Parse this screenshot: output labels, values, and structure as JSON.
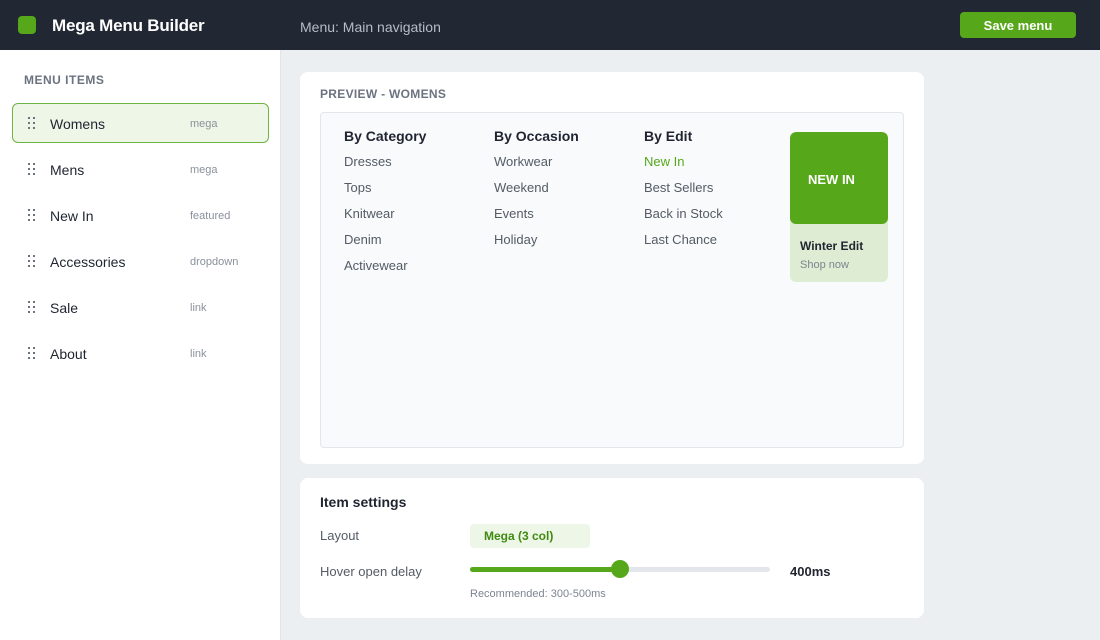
{
  "header": {
    "app_title": "Mega Menu Builder",
    "menu_name": "Menu: Main navigation",
    "save_label": "Save menu"
  },
  "sidebar": {
    "heading": "MENU ITEMS",
    "items": [
      {
        "label": "Womens",
        "type": "mega",
        "active": true
      },
      {
        "label": "Mens",
        "type": "mega"
      },
      {
        "label": "New In",
        "type": "featured"
      },
      {
        "label": "Accessories",
        "type": "dropdown"
      },
      {
        "label": "Sale",
        "type": "link"
      },
      {
        "label": "About",
        "type": "link"
      }
    ]
  },
  "preview": {
    "label": "PREVIEW",
    "separator": "-",
    "item": "WOMENS",
    "columns": [
      {
        "title": "By Category",
        "links": [
          "Dresses",
          "Tops",
          "Knitwear",
          "Denim",
          "Activewear"
        ]
      },
      {
        "title": "By Occasion",
        "links": [
          "Workwear",
          "Weekend",
          "Events",
          "Holiday"
        ]
      },
      {
        "title": "By Edit",
        "links": [
          "New In",
          "Best Sellers",
          "Back in Stock",
          "Last Chance"
        ],
        "highlighted_link": "New In"
      }
    ],
    "promo": {
      "banner_label": "NEW IN",
      "title": "Winter Edit",
      "cta": "Shop now"
    }
  },
  "settings": {
    "title": "Item settings",
    "layout_label": "Layout",
    "layout_value": "Mega (3 col)",
    "delay_label": "Hover open delay",
    "delay_value": "400ms",
    "delay_fraction": 0.5,
    "delay_hint": "Recommended: 300-500ms"
  },
  "colors": {
    "accent": "#56a81a",
    "topbar": "#212733",
    "active_bg": "#eef6e8"
  },
  "icons": {
    "logo": "logo-mark-icon",
    "drag": "drag-handle-icon"
  }
}
